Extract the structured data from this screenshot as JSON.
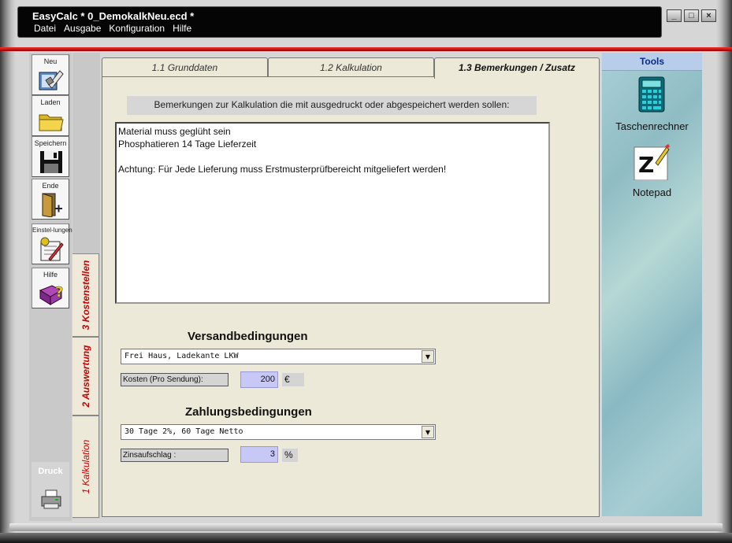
{
  "window": {
    "title": "EasyCalc * 0_DemokalkNeu.ecd *",
    "menu": [
      "Datei",
      "Ausgabe",
      "Konfiguration",
      "Hilfe"
    ],
    "controls": [
      "minimize",
      "maximize",
      "close"
    ]
  },
  "toolbar": {
    "items": [
      {
        "label": "Neu",
        "icon": "new-document-icon"
      },
      {
        "label": "Laden",
        "icon": "folder-icon"
      },
      {
        "label": "Speichern",
        "icon": "floppy-disk-icon"
      },
      {
        "label": "Ende",
        "icon": "exit-door-icon"
      },
      {
        "label": "Einstel-lungen",
        "icon": "settings-icon"
      },
      {
        "label": "Hilfe",
        "icon": "help-book-icon"
      }
    ],
    "print_label": "Druck",
    "print_icon": "printer-icon"
  },
  "side_tabs": [
    {
      "label": "3 Kostenstellen"
    },
    {
      "label": "2 Auswertung"
    },
    {
      "label": "1  Kalkulation"
    }
  ],
  "tabs": [
    {
      "label": "1.1 Grunddaten",
      "active": false
    },
    {
      "label": "1.2 Kalkulation",
      "active": false
    },
    {
      "label": "1.3 Bemerkungen / Zusatz",
      "active": true
    }
  ],
  "remarks": {
    "label": "Bemerkungen zur Kalkulation die mit ausgedruckt oder abgespeichert werden sollen:",
    "lines": [
      "Material muss geglüht sein",
      "Phosphatieren 14 Tage Lieferzeit",
      "",
      "Achtung: Für Jede Lieferung muss Erstmusterprüfbereicht mitgeliefert werden!"
    ]
  },
  "shipping": {
    "heading": "Versandbedingungen",
    "selected": "Frei Haus, Ladekante LKW",
    "cost_label": "Kosten (Pro Sendung):",
    "cost_value": "200",
    "cost_unit": "€"
  },
  "payment": {
    "heading": "Zahlungsbedingungen",
    "selected": "30 Tage 2%, 60 Tage Netto",
    "interest_label": "Zinsaufschlag  :",
    "interest_value": "3",
    "interest_unit": "%"
  },
  "tools": {
    "header": "Tools",
    "items": [
      {
        "label": "Taschenrechner",
        "icon": "calculator-icon"
      },
      {
        "label": "Notepad",
        "icon": "notepad-icon"
      }
    ]
  },
  "colors": {
    "accent_red": "#cc0000",
    "tools_header": "#b8cdea",
    "input_value_bg": "#c8c8f6",
    "panel_bg": "#ece9d8"
  }
}
